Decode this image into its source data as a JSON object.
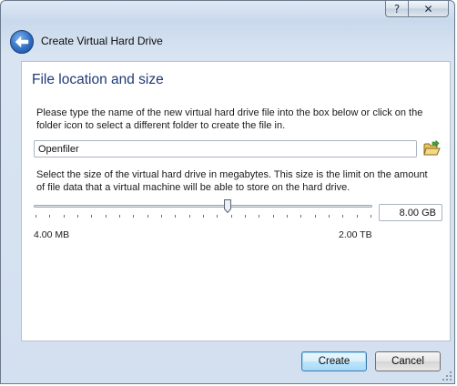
{
  "window": {
    "title": "Create Virtual Hard Drive",
    "help_symbol": "?",
    "close_symbol": "✕"
  },
  "page": {
    "heading": "File location and size",
    "location_description": "Please type the name of the new virtual hard drive file into the box below or click on the folder icon to select a different folder to create the file in.",
    "file_name": "Openfiler",
    "size_description": "Select the size of the virtual hard drive in megabytes. This size is the limit on the amount of file data that a virtual machine will be able to store on the hard drive.",
    "size_value": "8.00 GB",
    "slider_min_label": "4.00 MB",
    "slider_max_label": "2.00 TB",
    "slider_position": 0.575,
    "slider_tick_count": 25
  },
  "buttons": {
    "create_label": "Create",
    "cancel_label": "Cancel"
  },
  "icons": {
    "back": "back-arrow-icon",
    "folder": "folder-open-icon",
    "help": "help-icon",
    "close": "close-icon"
  }
}
